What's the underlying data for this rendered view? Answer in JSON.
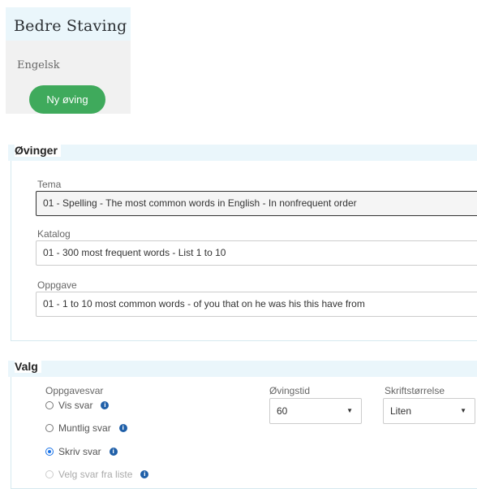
{
  "brand": {
    "title": "Bedre Staving",
    "subject": "Engelsk",
    "new_exercise_label": "Ny øving"
  },
  "ovinger": {
    "legend": "Øvinger",
    "tema": {
      "label": "Tema",
      "value": "01 - Spelling - The most common words in English - In nonfrequent order"
    },
    "katalog": {
      "label": "Katalog",
      "value": "01 - 300 most frequent words - List 1 to 10"
    },
    "oppgave": {
      "label": "Oppgave",
      "value": "01 - 1 to 10 most common words - of you that on he was his this have from"
    }
  },
  "valg": {
    "legend": "Valg",
    "oppgavesvar": {
      "label": "Oppgavesvar",
      "options": [
        {
          "label": "Vis svar",
          "checked": false,
          "disabled": false
        },
        {
          "label": "Muntlig svar",
          "checked": false,
          "disabled": false
        },
        {
          "label": "Skriv svar",
          "checked": true,
          "disabled": false
        },
        {
          "label": "Velg svar fra liste",
          "checked": false,
          "disabled": true
        }
      ]
    },
    "ovingstid": {
      "label": "Øvingstid",
      "value": "60"
    },
    "skriftstorrelse": {
      "label": "Skriftstørrelse",
      "value": "Liten"
    }
  },
  "colors": {
    "brand_bg": "#eaf6fb",
    "button_green": "#3faa5c",
    "radio_checked": "#1a73e8",
    "info_icon": "#1f5fa8"
  },
  "icons": [
    "caret-down-icon",
    "info-icon",
    "radio-icon"
  ]
}
